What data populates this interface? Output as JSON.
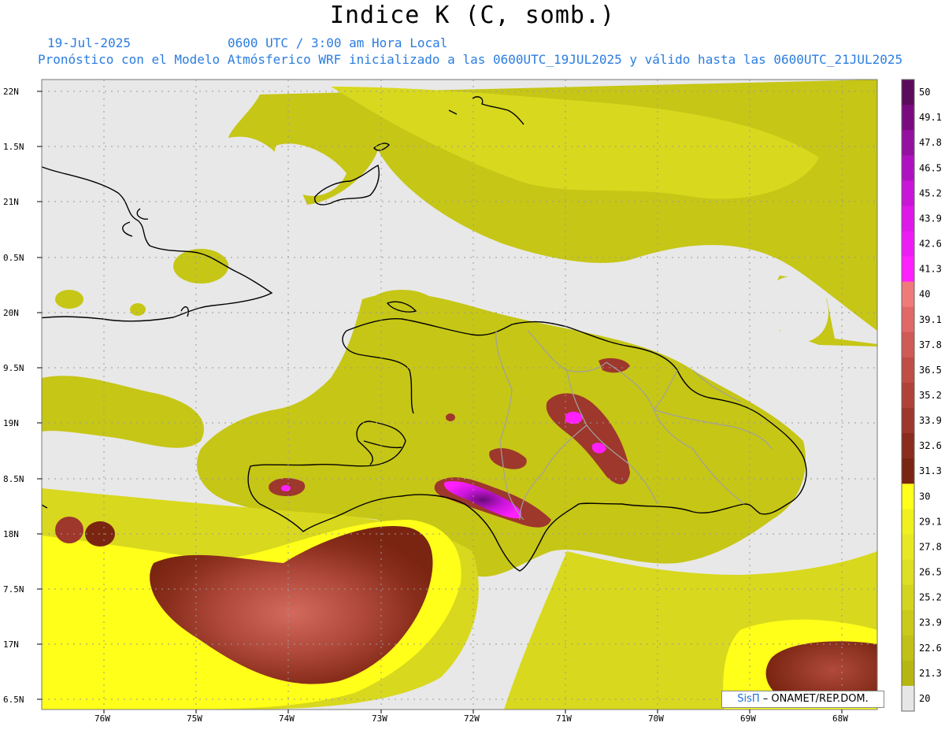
{
  "title": "Indice K (C, somb.)",
  "header": {
    "date": "19-Jul-2025",
    "time": "0600 UTC / 3:00 am Hora Local",
    "forecast_line": "Pronóstico con el Modelo Atmósferico WRF inicializado a las 0600UTC_19JUL2025 y válido hasta las  0600UTC_21JUL2025"
  },
  "axes": {
    "lat_labels": [
      "22N",
      "1.5N",
      "21N",
      "0.5N",
      "20N",
      "9.5N",
      "19N",
      "8.5N",
      "18N",
      "7.5N",
      "17N",
      "6.5N"
    ],
    "lon_labels": [
      "76W",
      "75W",
      "74W",
      "73W",
      "72W",
      "71W",
      "70W",
      "69W",
      "68W"
    ]
  },
  "colorbar": {
    "levels": [
      "50",
      "49.1",
      "47.8",
      "46.5",
      "45.2",
      "43.9",
      "42.6",
      "41.3",
      "40",
      "39.1",
      "37.8",
      "36.5",
      "35.2",
      "33.9",
      "32.6",
      "31.3",
      "30",
      "29.1",
      "27.8",
      "26.5",
      "25.2",
      "23.9",
      "22.6",
      "21.3",
      "20"
    ],
    "colors": [
      "#5c0a5c",
      "#7a0a80",
      "#9410a0",
      "#ae12c0",
      "#c815d8",
      "#dd18e8",
      "#ee1cf4",
      "#ff20ff",
      "#f07a7a",
      "#e06868",
      "#d05a55",
      "#c04e46",
      "#b04238",
      "#9e372c",
      "#8a2c1e",
      "#7a2512",
      "#ffff1a",
      "#f0f01e",
      "#e8e822",
      "#dede22",
      "#d4d41e",
      "#caca1a",
      "#c0c016",
      "#b6b612",
      "#e6e6e6"
    ]
  },
  "credit": {
    "brand": "SisΠ",
    "text": "– ONAMET/REP.DOM."
  }
}
